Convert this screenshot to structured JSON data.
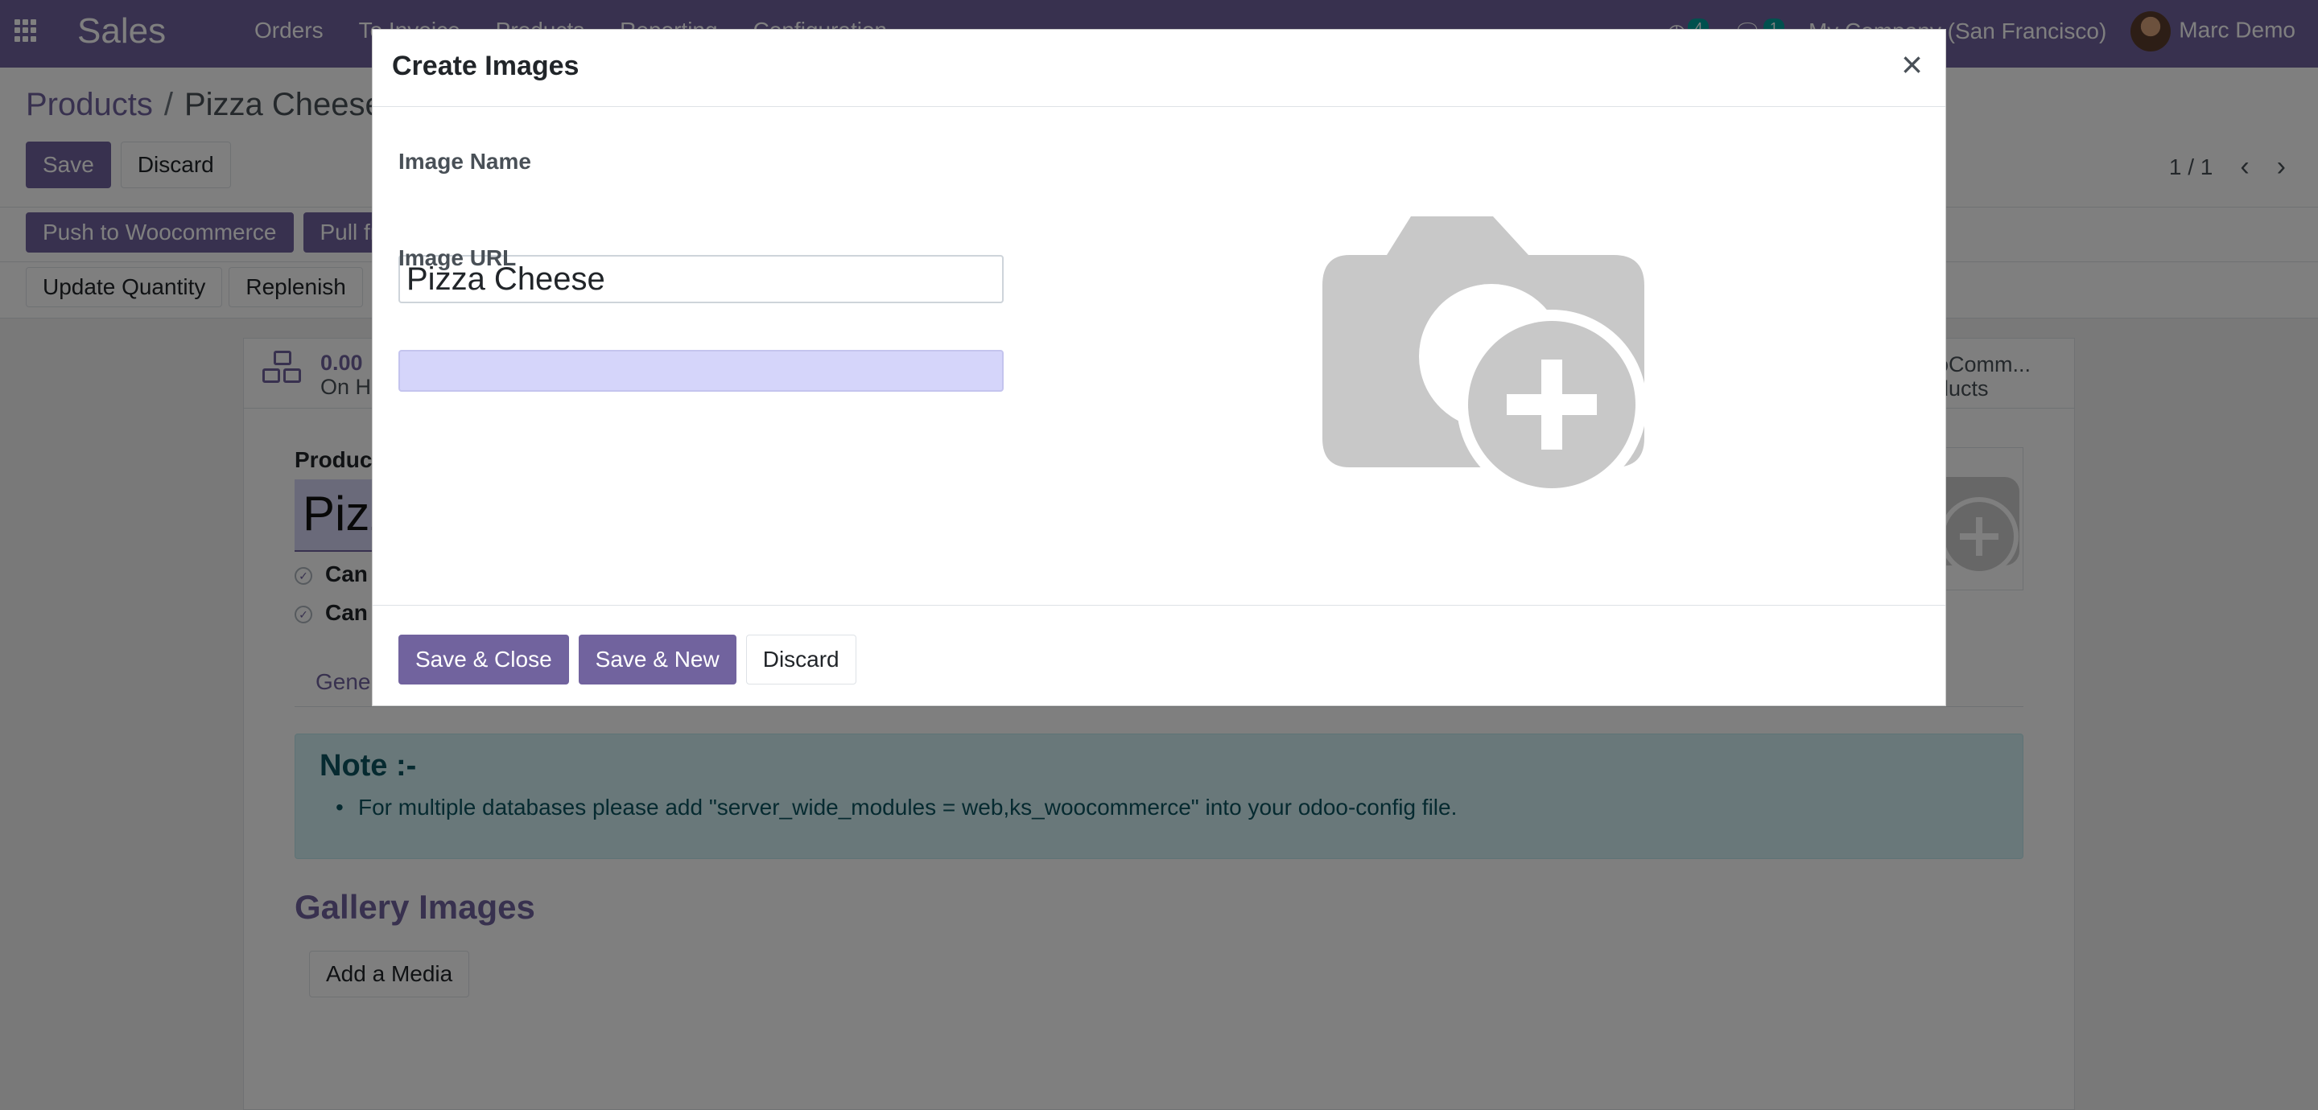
{
  "navbar": {
    "app_name": "Sales",
    "menu": [
      "Orders",
      "To Invoice",
      "Products",
      "Reporting",
      "Configuration"
    ],
    "activity_count": "4",
    "message_count": "1",
    "company": "My Company (San Francisco)",
    "user": "Marc Demo",
    "bg_color": "#71639e"
  },
  "control_panel": {
    "breadcrumb_parent": "Products",
    "breadcrumb_separator": "/",
    "breadcrumb_current": "Pizza Cheese",
    "save_label": "Save",
    "discard_label": "Discard",
    "pager": "1 / 1"
  },
  "statusbar": {
    "push_label": "Push to Woocommerce",
    "pull_label": "Pull fr",
    "update_quantity_label": "Update Quantity",
    "replenish_label": "Replenish"
  },
  "form": {
    "stat_value": "0.00",
    "stat_label": "On H",
    "woo_line1": "ooComm...",
    "woo_line2": "oducts",
    "product_label": "Product",
    "product_name": "Pizz",
    "can_be_sold": "Can",
    "can_be_purchased": "Can",
    "tab_general": "Gener",
    "note_title": "Note :-",
    "note_text": "For multiple databases please add \"server_wide_modules = web,ks_woocommerce\" into your odoo-config file.",
    "gallery_title": "Gallery Images",
    "add_media_label": "Add a Media"
  },
  "modal": {
    "title": "Create Images",
    "close_icon": "close-icon",
    "image_name_label": "Image Name",
    "image_name_value": "Pizza Cheese",
    "image_url_label": "Image URL",
    "image_url_value": "",
    "placeholder_icon": "camera-add-icon",
    "save_close_label": "Save & Close",
    "save_new_label": "Save & New",
    "discard_label": "Discard"
  }
}
